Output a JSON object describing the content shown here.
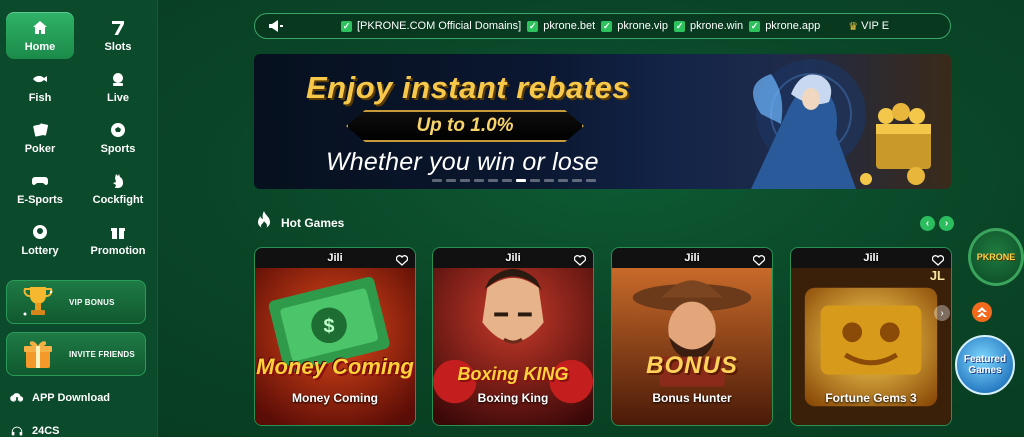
{
  "sidebar": {
    "nav": [
      {
        "label": "Home",
        "icon": "home-icon"
      },
      {
        "label": "Slots",
        "icon": "slots-icon"
      },
      {
        "label": "Fish",
        "icon": "fish-icon"
      },
      {
        "label": "Live",
        "icon": "live-icon"
      },
      {
        "label": "Poker",
        "icon": "poker-icon"
      },
      {
        "label": "Sports",
        "icon": "soccer-ball-icon"
      },
      {
        "label": "E-Sports",
        "icon": "gamepad-icon"
      },
      {
        "label": "Cockfight",
        "icon": "rooster-icon"
      },
      {
        "label": "Lottery",
        "icon": "lottery-ball-icon"
      },
      {
        "label": "Promotion",
        "icon": "gift-icon"
      }
    ],
    "promos": {
      "vip": "VIP BONUS",
      "invite": "INVITE FRIENDS"
    },
    "links": {
      "app_download": "APP Download",
      "cs": "24CS"
    }
  },
  "marquee": {
    "items": [
      "[PKRONE.COM Official Domains]",
      "pkrone.bet",
      "pkrone.vip",
      "pkrone.win",
      "pkrone.app"
    ],
    "tail": "VIP E"
  },
  "banner": {
    "title": "Enjoy instant rebates",
    "plate": "Up to 1.0%",
    "subtitle": "Whether you win or lose",
    "active_slide": 6,
    "slide_count": 12
  },
  "hot_games": {
    "title": "Hot Games",
    "games": [
      {
        "provider": "Jili",
        "name": "Money Coming",
        "logo": "Money Coming"
      },
      {
        "provider": "Jili",
        "name": "Boxing King",
        "logo": "Boxing KING"
      },
      {
        "provider": "Jili",
        "name": "Bonus Hunter",
        "logo": "BONUS"
      },
      {
        "provider": "Jili",
        "name": "Fortune Gems 3",
        "logo": "JL"
      }
    ]
  },
  "floaters": {
    "pk_logo": "PKRONE",
    "featured": "Featured Games"
  },
  "colors": {
    "accent_green": "#2bbd5e",
    "gold": "#f7c84a",
    "up_orange": "#f26a1b"
  }
}
